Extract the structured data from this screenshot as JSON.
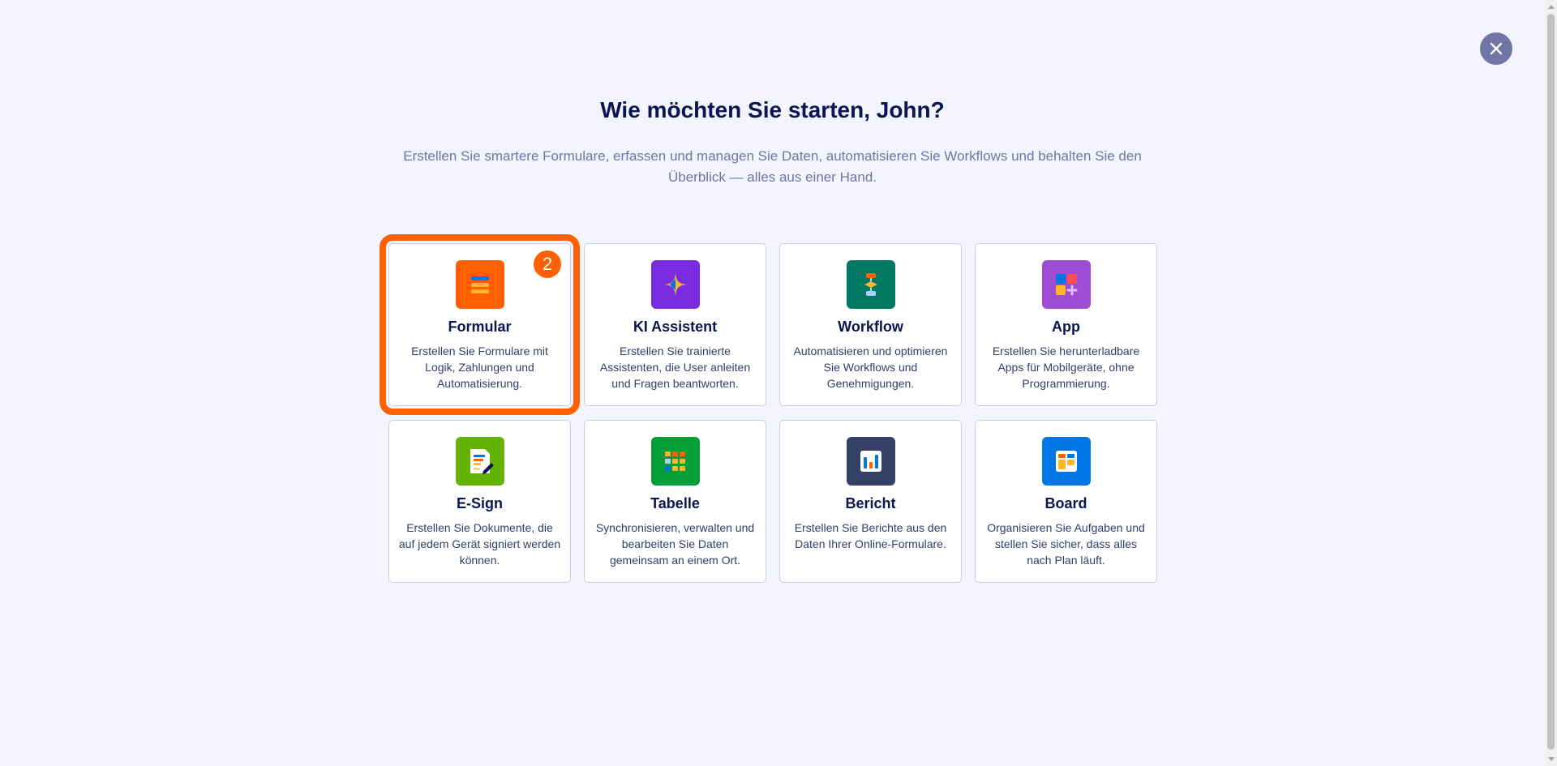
{
  "header": {
    "title": "Wie möchten Sie starten, John?",
    "subtitle": "Erstellen Sie smartere Formulare, erfassen und managen Sie Daten, automatisieren Sie Workflows und behalten Sie den Überblick — alles aus einer Hand."
  },
  "close": {
    "icon": "close-icon"
  },
  "badge": {
    "value": "2"
  },
  "colors": {
    "accent": "#ff6100",
    "title": "#0a1551",
    "subtitle": "#6f76a7",
    "background": "#f3f4fd"
  },
  "cards": [
    {
      "title": "Formular",
      "description": "Erstellen Sie Formulare mit Logik, Zahlungen und Automatisierung.",
      "icon": "form-icon",
      "color": "#ff6100"
    },
    {
      "title": "KI Assistent",
      "description": "Erstellen Sie trainierte Assistenten, die User anleiten und Fragen beantworten.",
      "icon": "ai-sparkle-icon",
      "color": "#7a2de0"
    },
    {
      "title": "Workflow",
      "description": "Automatisieren und optimieren Sie Workflows und Genehmigungen.",
      "icon": "workflow-icon",
      "color": "#007862"
    },
    {
      "title": "App",
      "description": "Erstellen Sie herunterladbare Apps für Mobilgeräte, ohne Programmierung.",
      "icon": "app-icon",
      "color": "#9c4dd3"
    },
    {
      "title": "E-Sign",
      "description": "Erstellen Sie Dokumente, die auf jedem Gerät signiert werden können.",
      "icon": "esign-icon",
      "color": "#64b200"
    },
    {
      "title": "Tabelle",
      "description": "Synchronisieren, verwalten und bearbeiten Sie Daten gemeinsam an einem Ort.",
      "icon": "table-icon",
      "color": "#049e38"
    },
    {
      "title": "Bericht",
      "description": "Erstellen Sie Berichte aus den Daten Ihrer Online-Formulare.",
      "icon": "report-icon",
      "color": "#344067"
    },
    {
      "title": "Board",
      "description": "Organisieren Sie Aufgaben und stellen Sie sicher, dass alles nach Plan läuft.",
      "icon": "board-icon",
      "color": "#0075e3"
    }
  ]
}
